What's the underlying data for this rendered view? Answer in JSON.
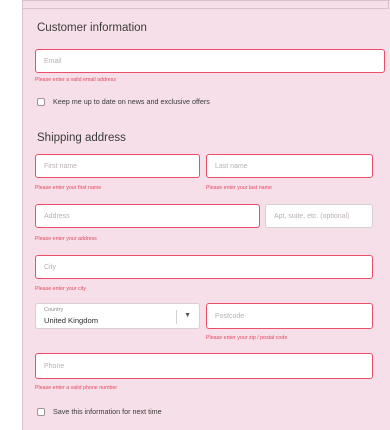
{
  "customer": {
    "heading": "Customer information",
    "email_placeholder": "Email",
    "email_error": "Please enter a valid email address",
    "newsletter_label": "Keep me up to date on news and exclusive offers"
  },
  "shipping": {
    "heading": "Shipping address",
    "first_name_placeholder": "First name",
    "first_name_error": "Please enter your first name",
    "last_name_placeholder": "Last name",
    "last_name_error": "Please enter your last name",
    "address_placeholder": "Address",
    "address_error": "Please enter your address",
    "apt_placeholder": "Apt, suite, etc. (optional)",
    "city_placeholder": "City",
    "city_error": "Please enter your city",
    "country_label": "Country",
    "country_value": "United Kingdom",
    "postcode_placeholder": "Postcode",
    "postcode_error": "Please enter your zip / postal code",
    "phone_placeholder": "Phone",
    "phone_error": "Please enter a valid phone number",
    "save_info_label": "Save this information for next time"
  }
}
